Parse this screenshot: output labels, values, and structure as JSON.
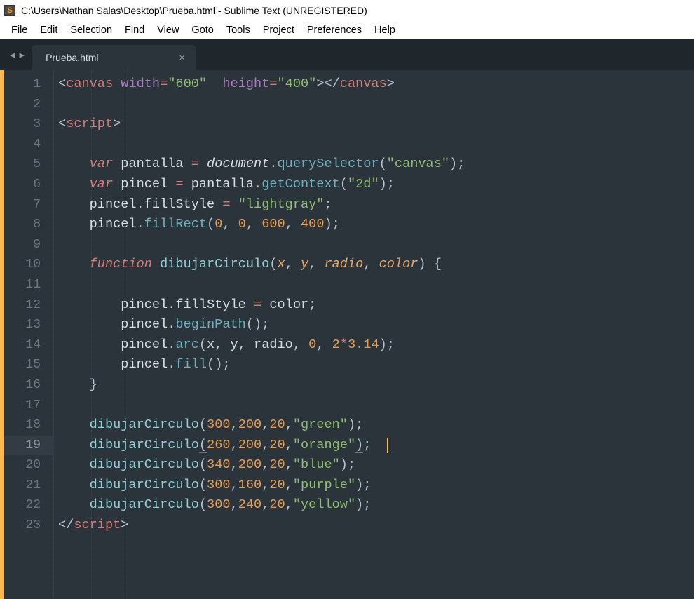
{
  "title": "C:\\Users\\Nathan Salas\\Desktop\\Prueba.html - Sublime Text (UNREGISTERED)",
  "menu": {
    "file": "File",
    "edit": "Edit",
    "selection": "Selection",
    "find": "Find",
    "view": "View",
    "goto": "Goto",
    "tools": "Tools",
    "project": "Project",
    "preferences": "Preferences",
    "help": "Help"
  },
  "nav": {
    "back": "◂",
    "forward": "▸"
  },
  "tab": {
    "name": "Prueba.html",
    "close": "×"
  },
  "activeLine": 19,
  "lines": [
    1,
    2,
    3,
    4,
    5,
    6,
    7,
    8,
    9,
    10,
    11,
    12,
    13,
    14,
    15,
    16,
    17,
    18,
    19,
    20,
    21,
    22,
    23
  ],
  "code": {
    "canvas": {
      "tag": "canvas",
      "w_attr": "width",
      "w_val": "\"600\"",
      "h_attr": "height",
      "h_val": "\"400\""
    },
    "script": {
      "tag": "script"
    },
    "l5": {
      "var": "var",
      "id": "pantalla",
      "eq": "=",
      "doc": "document",
      "fn": "querySelector",
      "arg": "\"canvas\""
    },
    "l6": {
      "var": "var",
      "id": "pincel",
      "eq": "=",
      "src": "pantalla",
      "fn": "getContext",
      "arg": "\"2d\""
    },
    "l7": {
      "obj": "pincel",
      "prop": "fillStyle",
      "eq": "=",
      "val": "\"lightgray\""
    },
    "l8": {
      "obj": "pincel",
      "fn": "fillRect",
      "a": "0",
      "b": "0",
      "c": "600",
      "d": "400"
    },
    "l10": {
      "kw": "function",
      "name": "dibujarCirculo",
      "p1": "x",
      "p2": "y",
      "p3": "radio",
      "p4": "color"
    },
    "l12": {
      "obj": "pincel",
      "prop": "fillStyle",
      "eq": "=",
      "val": "color"
    },
    "l13": {
      "obj": "pincel",
      "fn": "beginPath"
    },
    "l14": {
      "obj": "pincel",
      "fn": "arc",
      "a": "x",
      "b": "y",
      "c": "radio",
      "d": "0",
      "e": "2",
      "op": "*",
      "f": "3.14"
    },
    "l15": {
      "obj": "pincel",
      "fn": "fill"
    },
    "l18": {
      "fn": "dibujarCirculo",
      "a": "300",
      "b": "200",
      "c": "20",
      "d": "\"green\""
    },
    "l19": {
      "fn": "dibujarCirculo",
      "a": "260",
      "b": "200",
      "c": "20",
      "d": "\"orange\""
    },
    "l20": {
      "fn": "dibujarCirculo",
      "a": "340",
      "b": "200",
      "c": "20",
      "d": "\"blue\""
    },
    "l21": {
      "fn": "dibujarCirculo",
      "a": "300",
      "b": "160",
      "c": "20",
      "d": "\"purple\""
    },
    "l22": {
      "fn": "dibujarCirculo",
      "a": "300",
      "b": "240",
      "c": "20",
      "d": "\"yellow\""
    }
  }
}
